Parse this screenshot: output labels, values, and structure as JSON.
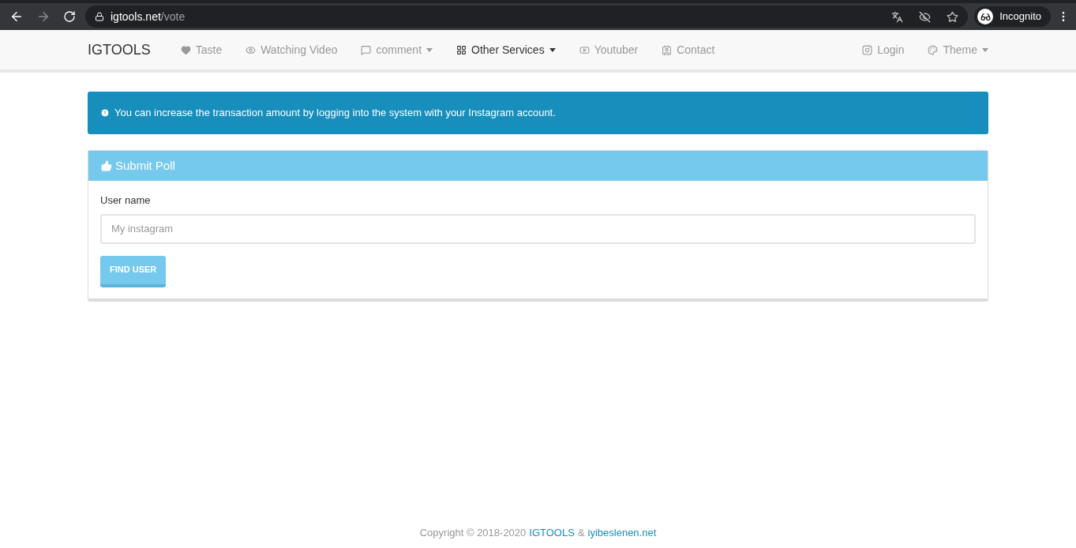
{
  "browser": {
    "url_host": "igtools.net",
    "url_path": "/vote",
    "profile": "Incognito"
  },
  "navbar": {
    "brand": "IGTOOLS",
    "items": [
      {
        "label": "Taste",
        "selected": false,
        "dropdown": false
      },
      {
        "label": "Watching Video",
        "selected": false,
        "dropdown": false
      },
      {
        "label": "comment",
        "selected": false,
        "dropdown": true
      },
      {
        "label": "Other Services",
        "selected": true,
        "dropdown": true
      },
      {
        "label": "Youtuber",
        "selected": false,
        "dropdown": false
      },
      {
        "label": "Contact",
        "selected": false,
        "dropdown": false
      }
    ],
    "right_items": [
      {
        "label": "Login",
        "selected": false,
        "dropdown": false
      },
      {
        "label": "Theme",
        "selected": false,
        "dropdown": true
      }
    ]
  },
  "alert": {
    "text": "You can increase the transaction amount by logging into the system with your Instagram account."
  },
  "panel": {
    "title": "Submit Poll",
    "field_label": "User name",
    "placeholder": "My instagram",
    "button": "FIND USER"
  },
  "footer": {
    "copyright": "Copyright © 2018-2020",
    "brand_link": "IGTOOLS",
    "separator": "&",
    "site_link": "iyibeslenen.net"
  }
}
